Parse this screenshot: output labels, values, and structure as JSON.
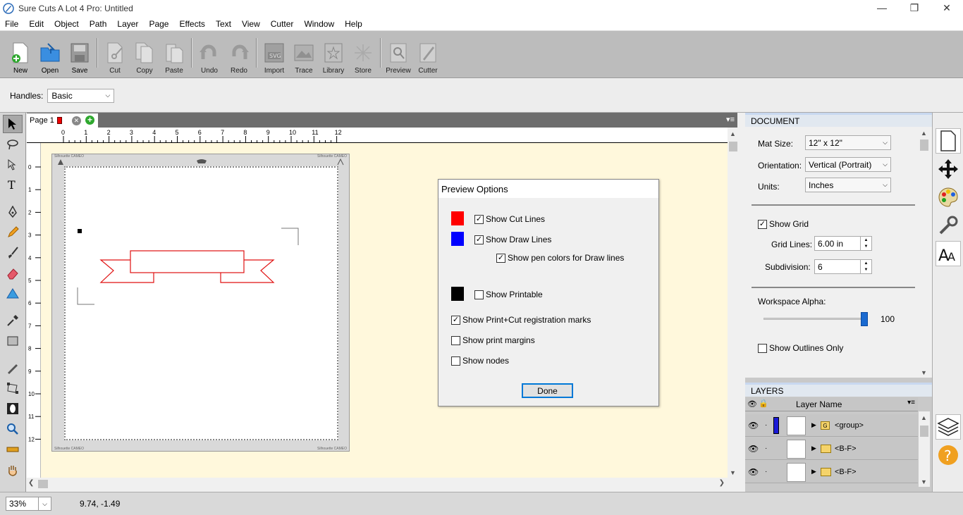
{
  "window": {
    "title": "Sure Cuts A Lot 4 Pro: Untitled"
  },
  "menu": [
    "File",
    "Edit",
    "Object",
    "Path",
    "Layer",
    "Page",
    "Effects",
    "Text",
    "View",
    "Cutter",
    "Window",
    "Help"
  ],
  "toolbar": {
    "new": "New",
    "open": "Open",
    "save": "Save",
    "cut": "Cut",
    "copy": "Copy",
    "paste": "Paste",
    "undo": "Undo",
    "redo": "Redo",
    "import": "Import",
    "trace": "Trace",
    "library": "Library",
    "store": "Store",
    "preview": "Preview",
    "cutter": "Cutter"
  },
  "options": {
    "handles_label": "Handles:",
    "handles_value": "Basic"
  },
  "page_tab": {
    "label": "Page 1"
  },
  "ruler": {
    "h_ticks": [
      "0",
      "1",
      "2",
      "3",
      "4",
      "5",
      "6",
      "7",
      "8",
      "9",
      "10",
      "11",
      "12"
    ],
    "v_ticks": [
      "0",
      "1",
      "2",
      "3",
      "4",
      "5",
      "6",
      "7",
      "8",
      "9",
      "10",
      "11",
      "12"
    ]
  },
  "mat": {
    "brand_text": "Silhouette CAMEO"
  },
  "status": {
    "zoom": "33%",
    "coords": "9.74, -1.49"
  },
  "document_panel": {
    "header": "DOCUMENT",
    "mat_size_label": "Mat Size:",
    "mat_size_value": "12\" x 12\"",
    "orientation_label": "Orientation:",
    "orientation_value": "Vertical (Portrait)",
    "units_label": "Units:",
    "units_value": "Inches",
    "show_grid_label": "Show Grid",
    "show_grid": true,
    "grid_lines_label": "Grid Lines:",
    "grid_lines_value": "6.00 in",
    "subdivision_label": "Subdivision:",
    "subdivision_value": "6",
    "alpha_label": "Workspace Alpha:",
    "alpha_value": "100",
    "alpha_level": 1.0,
    "outlines_label": "Show Outlines Only",
    "outlines": false
  },
  "layers_panel": {
    "header": "LAYERS",
    "column": "Layer Name",
    "rows": [
      {
        "name": "<group>",
        "color": "#1a1ad6",
        "type": "group"
      },
      {
        "name": "<B-F>",
        "color": "",
        "type": "folder"
      },
      {
        "name": "<B-F>",
        "color": "",
        "type": "folder"
      }
    ]
  },
  "dialog": {
    "title": "Preview Options",
    "cut_lines": "Show Cut Lines",
    "draw_lines": "Show Draw Lines",
    "pen_colors": "Show pen colors for Draw lines",
    "printable": "Show Printable",
    "reg_marks": "Show Print+Cut registration marks",
    "print_margins": "Show print margins",
    "nodes": "Show nodes",
    "done": "Done",
    "colors": {
      "cut": "#ff0000",
      "draw": "#0000ff",
      "print": "#000000"
    }
  }
}
